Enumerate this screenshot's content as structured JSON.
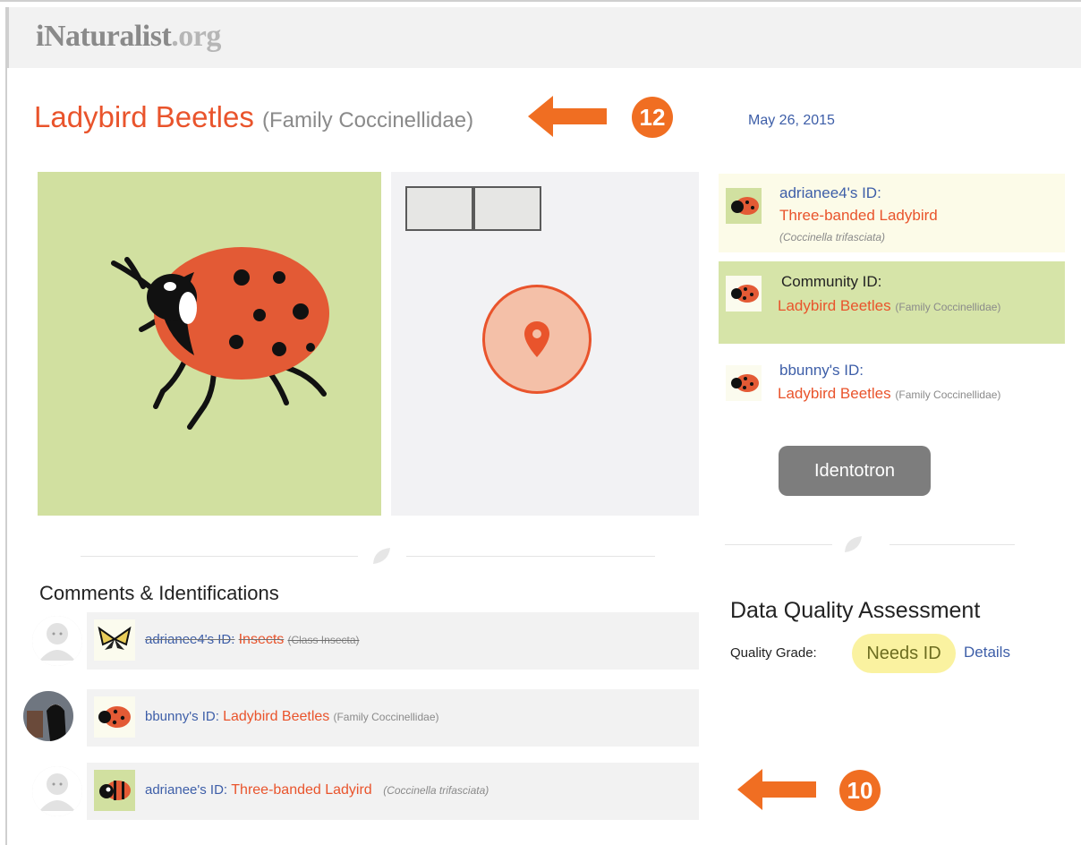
{
  "header": {
    "logo_main": "iNaturalist",
    "logo_suffix": ".org"
  },
  "observation": {
    "title": "Ladybird Beetles",
    "title_rank": "(Family Coccinellidae)",
    "date": "May 26, 2015"
  },
  "annotations": {
    "badge_top": "12",
    "badge_bottom": "10",
    "arrow_color": "#f06e22"
  },
  "identifications": [
    {
      "user": "adrianee4's ID:",
      "taxon": "Three-banded Ladybird",
      "scientific": "(Coccinella trifasciata)",
      "rank": "",
      "background": "#fcfbe8"
    },
    {
      "user": "Community ID:",
      "taxon": "Ladybird Beetles",
      "scientific": "",
      "rank": "(Family Coccinellidae)",
      "background": "#d6e4a8"
    },
    {
      "user": "bbunny's ID:",
      "taxon": "Ladybird Beetles",
      "scientific": "",
      "rank": "(Family Coccinellidae)",
      "background": "#ffffff"
    }
  ],
  "identotron_label": "Identotron",
  "comments": {
    "heading": "Comments & Identifications",
    "rows": [
      {
        "user": "adrianee4's ID:",
        "taxon": "Insects",
        "rank": "(Class Insecta)",
        "withdrawn": true,
        "avatar_icon": "default-avatar-icon",
        "thumb_icon": "swallowtail-butterfly-icon"
      },
      {
        "user": "bbunny's ID:",
        "taxon": "Ladybird Beetles",
        "rank": "(Family Coccinellidae)",
        "withdrawn": false,
        "avatar_icon": "user-photo-avatar",
        "thumb_icon": "ladybug-icon"
      },
      {
        "user": "adrianee's ID:",
        "taxon": "Three-banded Ladyird",
        "rank": "(Coccinella trifasciata)",
        "withdrawn": false,
        "avatar_icon": "default-avatar-icon",
        "thumb_icon": "three-banded-ladybird-icon"
      }
    ]
  },
  "data_quality": {
    "heading": "Data Quality Assessment",
    "grade_label": "Quality Grade:",
    "grade_value": "Needs ID",
    "details_link": "Details"
  },
  "colors": {
    "accent_orange": "#e9542c",
    "link_blue": "#3d5ea8",
    "photo_bg": "#d1e0a0",
    "community_bg": "#d6e4a8",
    "needs_id_bg": "#faf2a0"
  }
}
